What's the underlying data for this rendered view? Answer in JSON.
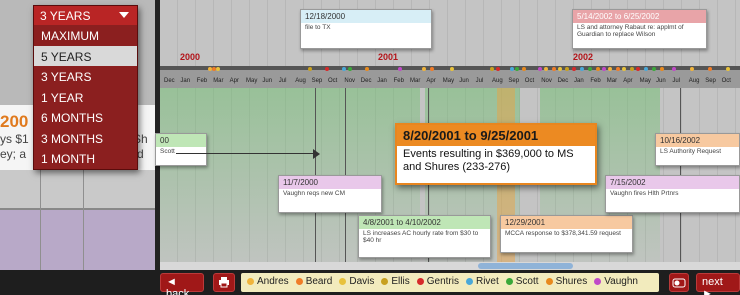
{
  "range_selector": {
    "selected": "3 YEARS",
    "options": [
      "MAXIMUM",
      "5 YEARS",
      "3 YEARS",
      "1 YEAR",
      "6 MONTHS",
      "3 MONTHS",
      "1 MONTH"
    ],
    "highlighted_option": "5 YEARS"
  },
  "left_panel": {
    "card_title": "200",
    "line1": "ys $1",
    "line1b": "Sh",
    "line2": "ey; a",
    "line2b": "d"
  },
  "timeline": {
    "years": [
      "2000",
      "2001",
      "2002"
    ],
    "months": [
      "Dec",
      "Jan",
      "Feb",
      "Mar",
      "Apr",
      "May",
      "Jun",
      "Jul",
      "Aug",
      "Sep",
      "Oct",
      "Nov",
      "Dec",
      "Jan",
      "Feb",
      "Mar",
      "Apr",
      "May",
      "Jun",
      "Jul",
      "Aug",
      "Sep",
      "Oct",
      "Nov",
      "Dec",
      "Jan",
      "Feb",
      "Mar",
      "Apr",
      "May",
      "Jun",
      "Jul",
      "Aug",
      "Sep",
      "Oct"
    ]
  },
  "events": [
    {
      "id": "e1",
      "title": "12/18/2000",
      "body": "file to TX",
      "color": "blue"
    },
    {
      "id": "e2",
      "title": "5/14/2002 to 6/25/2002",
      "body": "LS and attorney Rabaut re: applmt of Guardian to replace Wilson",
      "color": "pink"
    },
    {
      "id": "e3",
      "title": "00",
      "body": "Scott",
      "color": "green"
    },
    {
      "id": "e4",
      "title": "11/7/2000",
      "body": "Vaughn reqs new CM",
      "color": "purple"
    },
    {
      "id": "e5",
      "title": "4/8/2001 to 4/10/2002",
      "body": "LS increases AC hourly rate from $30 to $40 hr",
      "color": "green"
    },
    {
      "id": "e6",
      "title": "12/29/2001",
      "body": "MCCA response to $378,341.59 request",
      "color": "orange"
    },
    {
      "id": "e7",
      "title": "10/16/2002",
      "body": "LS Authority Request",
      "color": "orange"
    },
    {
      "id": "e8",
      "title": "7/15/2002",
      "body": "Vaughn fires Hlth Prtnrs",
      "color": "purple"
    }
  ],
  "featured_event": {
    "title": "8/20/2001 to 9/25/2001",
    "body": "Events resulting in $369,000 to MS and Shures (233-276)"
  },
  "bottom_bar": {
    "back_label": "◄ back",
    "next_label": "next ►",
    "legend": [
      {
        "name": "Andres",
        "color": "#f0b43c"
      },
      {
        "name": "Beard",
        "color": "#f07c28"
      },
      {
        "name": "Davis",
        "color": "#e8c23c"
      },
      {
        "name": "Ellis",
        "color": "#c8a01e"
      },
      {
        "name": "Gentris",
        "color": "#d62a2a"
      },
      {
        "name": "Rivet",
        "color": "#4aa8d8"
      },
      {
        "name": "Scott",
        "color": "#3aa83a"
      },
      {
        "name": "Shures",
        "color": "#e88a1e"
      },
      {
        "name": "Vaughn",
        "color": "#c04ac8"
      }
    ]
  }
}
